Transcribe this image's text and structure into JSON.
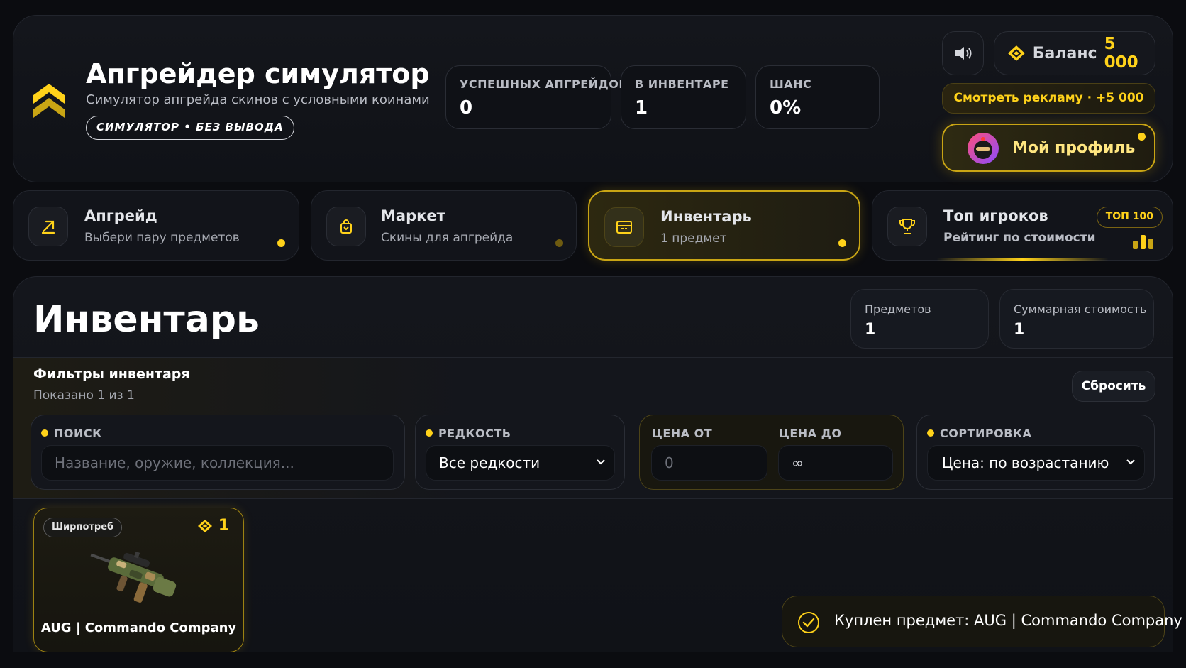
{
  "header": {
    "title": "Апгрейдер симулятор",
    "subtitle": "Симулятор апгрейда скинов с условными коинами",
    "badge": "СИМУЛЯТОР • БЕЗ ВЫВОДА",
    "stats": [
      {
        "label": "УСПЕШНЫХ АПГРЕЙДОВ",
        "value": "0"
      },
      {
        "label": "В ИНВЕНТАРЕ",
        "value": "1"
      },
      {
        "label": "ШАНС",
        "value": "0%"
      }
    ],
    "balance_label": "Баланс",
    "balance_value": "5 000",
    "ad_button": "Смотреть рекламу · +5 000",
    "profile_button": "Мой профиль",
    "colors": {
      "accent": "#ffd21a",
      "background": "#0b0c10"
    }
  },
  "tabs": [
    {
      "title": "Апгрейд",
      "subtitle": "Выбери пару предметов",
      "icon": "upgrade-arrow-icon",
      "active": false
    },
    {
      "title": "Маркет",
      "subtitle": "Скины для апгрейда",
      "icon": "shopping-bag-icon",
      "active": false
    },
    {
      "title": "Инвентарь",
      "subtitle": "1 предмет",
      "icon": "inventory-box-icon",
      "active": true
    },
    {
      "title": "Топ игроков",
      "subtitle": "Рейтинг по стоимости",
      "icon": "trophy-icon",
      "badge": "ТОП 100",
      "active": false
    }
  ],
  "inventory": {
    "title": "Инвентарь",
    "summary": [
      {
        "label": "Предметов",
        "value": "1"
      },
      {
        "label": "Суммарная стоимость",
        "value": "1"
      }
    ],
    "filters": {
      "title": "Фильтры инвентаря",
      "count_text": "Показано 1 из 1",
      "reset": "Сбросить",
      "search_label": "ПОИСК",
      "search_placeholder": "Название, оружие, коллекция...",
      "rarity_label": "РЕДКОСТЬ",
      "rarity_value": "Все редкости",
      "price_from_label": "ЦЕНА ОТ",
      "price_from_placeholder": "0",
      "price_to_label": "ЦЕНА ДО",
      "price_to_placeholder": "∞",
      "sort_label": "СОРТИРОВКА",
      "sort_value": "Цена: по возрастанию"
    },
    "items": [
      {
        "rarity": "Ширпотреб",
        "price": "1",
        "name": "AUG | Commando Company"
      }
    ]
  },
  "toast": {
    "text": "Куплен предмет: AUG | Commando Company"
  }
}
